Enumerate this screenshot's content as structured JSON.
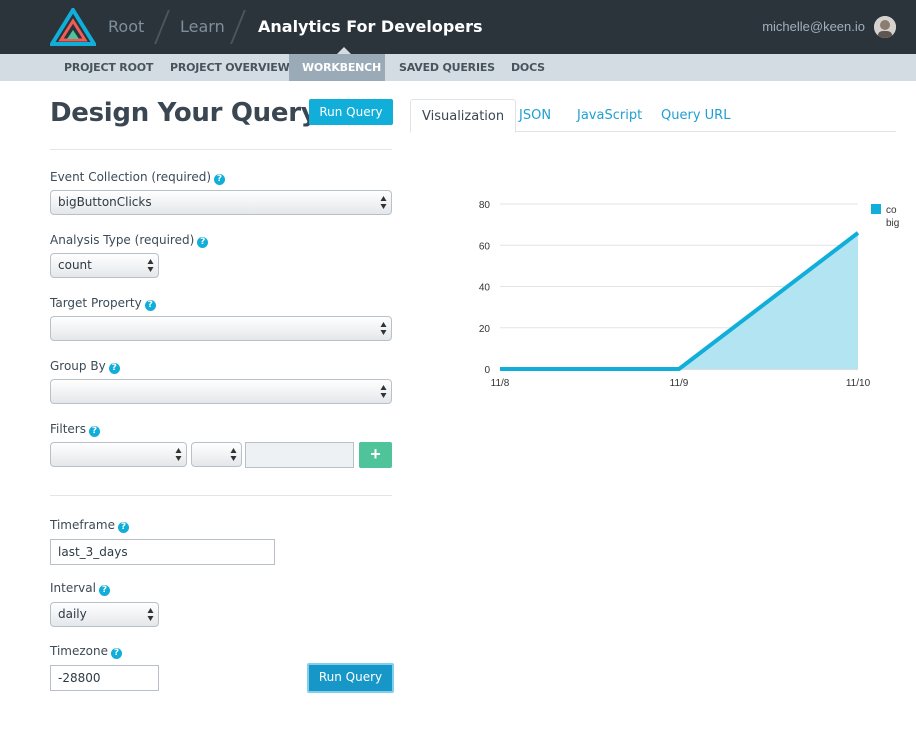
{
  "header": {
    "breadcrumbs": [
      "Root",
      "Learn",
      "Analytics For Developers"
    ],
    "user_email": "michelle@keen.io"
  },
  "subnav": {
    "items": [
      "PROJECT ROOT",
      "PROJECT OVERVIEW",
      "WORKBENCH",
      "SAVED QUERIES",
      "DOCS"
    ],
    "active": "WORKBENCH"
  },
  "query": {
    "title": "Design Your Query",
    "run_label": "Run Query",
    "help_glyph": "?",
    "plus_glyph": "+",
    "fields": {
      "event_collection": {
        "label": "Event Collection (required)",
        "value": "bigButtonClicks"
      },
      "analysis_type": {
        "label": "Analysis Type (required)",
        "value": "count"
      },
      "target_property": {
        "label": "Target Property",
        "value": ""
      },
      "group_by": {
        "label": "Group By",
        "value": ""
      },
      "filters": {
        "label": "Filters",
        "property": "",
        "operator": "",
        "value": ""
      },
      "timeframe": {
        "label": "Timeframe",
        "value": "last_3_days"
      },
      "interval": {
        "label": "Interval",
        "value": "daily"
      },
      "timezone": {
        "label": "Timezone",
        "value": "-28800"
      }
    }
  },
  "results": {
    "tabs": [
      "Visualization",
      "JSON",
      "JavaScript",
      "Query URL"
    ],
    "active_tab": "Visualization"
  },
  "colors": {
    "accent": "#10aed9",
    "chart_line": "#10aed9",
    "chart_fill": "#b3e4f2",
    "plus_button": "#4fc39a",
    "topbar": "#2b333b"
  },
  "chart_data": {
    "type": "area",
    "x": [
      "11/8",
      "11/9",
      "11/10"
    ],
    "series": [
      {
        "name": "co big",
        "values": [
          0,
          0,
          66
        ]
      }
    ],
    "yticks": [
      0,
      20,
      40,
      60,
      80
    ],
    "ylim": [
      0,
      80
    ],
    "grid": true,
    "legend": "right",
    "legend_visible_text": [
      "co",
      "big"
    ]
  }
}
